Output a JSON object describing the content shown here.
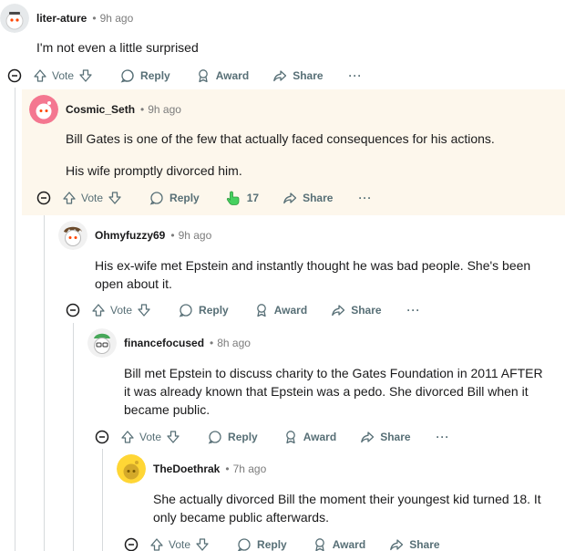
{
  "comments": [
    {
      "username": "liter-ature",
      "time": "9h ago",
      "body": [
        "I'm not even a little surprised"
      ],
      "vote_label": "Vote",
      "reply_label": "Reply",
      "award_label": "Award",
      "share_label": "Share"
    },
    {
      "username": "Cosmic_Seth",
      "time": "9h ago",
      "body": [
        "Bill Gates is one of the few that actually faced consequences for his actions.",
        "His wife promptly divorced him."
      ],
      "vote_label": "Vote",
      "reply_label": "Reply",
      "award_count": "17",
      "share_label": "Share"
    },
    {
      "username": "Ohmyfuzzy69",
      "time": "9h ago",
      "body": [
        "His ex-wife met Epstein and instantly thought he was bad people. She's been open about it."
      ],
      "vote_label": "Vote",
      "reply_label": "Reply",
      "award_label": "Award",
      "share_label": "Share"
    },
    {
      "username": "financefocused",
      "time": "8h ago",
      "body": [
        "Bill met Epstein to discuss charity to the Gates Foundation in 2011 AFTER it was already known that Epstein was a pedo. She divorced Bill when it became public."
      ],
      "vote_label": "Vote",
      "reply_label": "Reply",
      "award_label": "Award",
      "share_label": "Share"
    },
    {
      "username": "TheDoethrak",
      "time": "7h ago",
      "body": [
        "She actually divorced Bill the moment their youngest kid turned 18. It only became public afterwards."
      ],
      "vote_label": "Vote",
      "reply_label": "Reply",
      "award_label": "Award",
      "share_label": "Share"
    }
  ],
  "separator": "•",
  "more_label": "···",
  "colors": {
    "highlight_bg": "#fdf7ec",
    "thread_line": "#d7dadc",
    "meta": "#576f76",
    "award_hand": "#46d160"
  }
}
